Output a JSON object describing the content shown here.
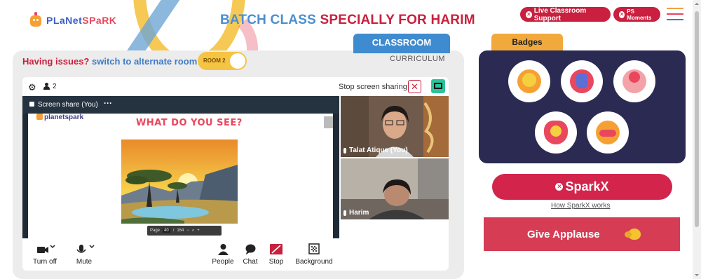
{
  "header": {
    "logo_part1": "PLaNet",
    "logo_part2": "SPaRK",
    "title_part1": "BATCH CLASS",
    "title_part2": "SPECIALLY FOR HARIM",
    "live_support_label": "Live Classroom Support",
    "ps_moments_label": "PS Moments",
    "menu_icon": "hamburger-icon"
  },
  "tabs": {
    "classroom": "CLASSROOM",
    "curriculum": "CURRICULUM"
  },
  "room_switch": {
    "issue_text": "Having issues?",
    "link_text": "switch to alternate room",
    "room_label": "ROOM 2"
  },
  "meeting": {
    "participant_count": "2",
    "stop_sharing_label": "Stop screen sharing",
    "share_label": "Screen share (You)",
    "slide_brand": "planetspark",
    "slide_question": "WHAT DO YOU SEE?",
    "pdf_page_label": "Page",
    "pdf_page": "40",
    "pdf_total": "164",
    "participants": [
      {
        "name": "Talat Atique (You)"
      },
      {
        "name": "Harim"
      }
    ],
    "controls": {
      "video": "Turn off",
      "mic": "Mute",
      "people": "People",
      "chat": "Chat",
      "stop": "Stop",
      "background": "Background"
    }
  },
  "badges": {
    "title": "Badges",
    "icons": [
      "trophy-badge-icon",
      "raised-hand-badge-icon",
      "astronaut-badge-icon",
      "lightbulb-badge-icon",
      "brain-badge-icon"
    ]
  },
  "sparkx": {
    "label": "SparkX",
    "how_link": "How SparkX works"
  },
  "applause": {
    "label": "Give Applause"
  },
  "colors": {
    "brand_red": "#c8203e",
    "brand_blue": "#3f8bcf",
    "badge_bg": "#2a2a52",
    "badge_tab": "#f2a93b"
  }
}
